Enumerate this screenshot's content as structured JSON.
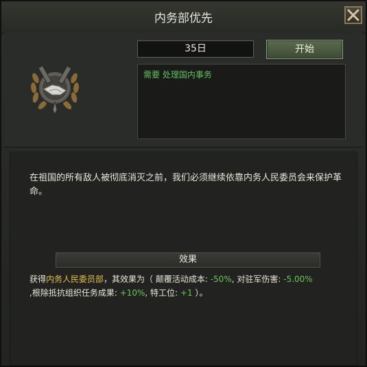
{
  "window": {
    "title": "内务部优先"
  },
  "icons": {
    "close": "close-icon",
    "emblem": "handshake-laurel-emblem-icon"
  },
  "decision": {
    "duration": "35日",
    "start_label": "开始",
    "requirement": "需要 处理国内事务"
  },
  "body": {
    "description": "在祖国的所有敌人被彻底消灭之前，我们必须继续依靠内务人民委员会来保护革命。",
    "effects_header": "效果",
    "effects": {
      "prefix": "获得",
      "advisor": "内务人民委员部",
      "mid1": "，其效果为（ 颠覆活动成本: ",
      "val1": "-50%",
      "mid2": ", 对驻军伤害: ",
      "val2": "-5.00%",
      "mid3": ",\n根除抵抗组织任务成果: ",
      "val3": "+10%",
      "mid4": ", 特工位: ",
      "val4": "+1",
      "suffix": " ）。"
    }
  },
  "colors": {
    "highlight_name": "#e3c04c",
    "highlight_value": "#6cc25c",
    "requirement_text": "#63c060"
  }
}
